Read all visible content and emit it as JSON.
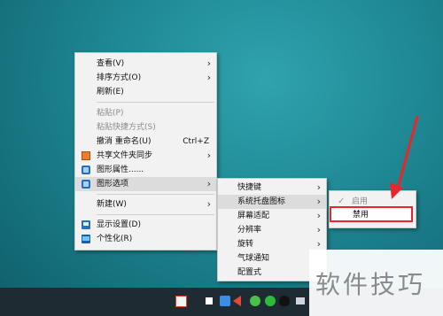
{
  "main_menu": {
    "view": "查看(V)",
    "sort": "排序方式(O)",
    "refresh": "刷新(E)",
    "paste": "粘贴(P)",
    "paste_shortcut": "粘贴快捷方式(S)",
    "undo": "撤消 重命名(U)",
    "undo_shortcut": "Ctrl+Z",
    "share_sync": "共享文件夹同步",
    "graphics_properties": "图形属性......",
    "graphics_options": "图形选项",
    "new": "新建(W)",
    "display_settings": "显示设置(D)",
    "personalize": "个性化(R)"
  },
  "sub_menu": {
    "hotkeys": "快捷键",
    "tray_icon": "系统托盘图标",
    "screen_fit": "屏幕适配",
    "resolution": "分辨率",
    "rotate": "旋转",
    "balloon": "气球通知",
    "config": "配置式"
  },
  "tray_menu": {
    "enable": "启用",
    "disable": "禁用"
  },
  "watermark": "软件技巧",
  "icons": {
    "arrow": "›",
    "check": "✓"
  },
  "colors": {
    "annotation_red": "#e8262c",
    "desktop_teal": "#1f8994"
  }
}
